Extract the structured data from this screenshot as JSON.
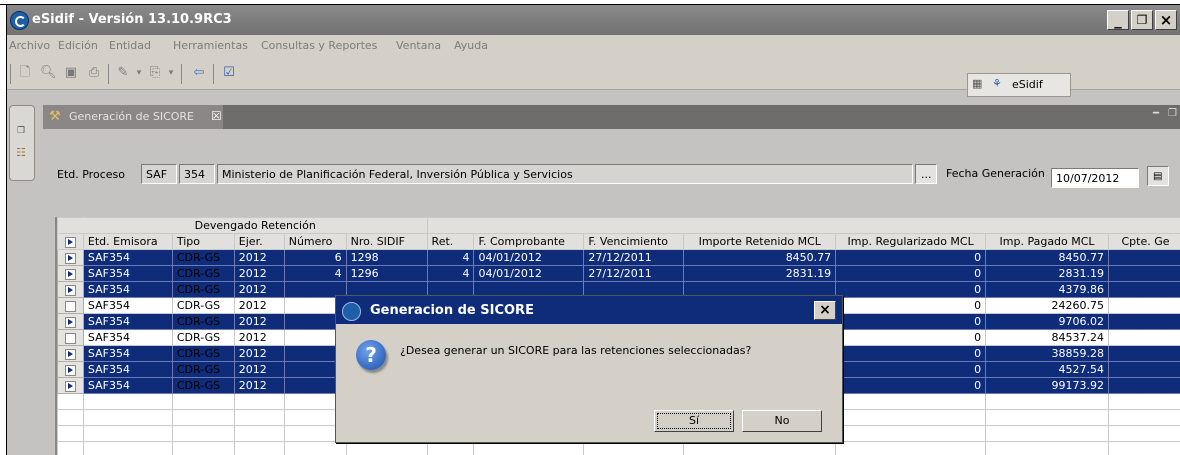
{
  "window": {
    "title": "eSidif - Versión 13.10.9RC3"
  },
  "menu": [
    "Archivo",
    "Edición",
    "Entidad",
    "Herramientas",
    "Consultas y Reportes",
    "Ventana",
    "Ayuda"
  ],
  "toolbar": {
    "perspective_label": "eSidif"
  },
  "tab": {
    "label": "Generación de SICORE"
  },
  "form": {
    "etd_proceso_label": "Etd. Proceso",
    "saf_code": "SAF",
    "saf_number": "354",
    "saf_name": "Ministerio de Planificación Federal, Inversión Pública y Servicios",
    "browse_label": "...",
    "fecha_label": "Fecha Generación",
    "fecha_value": "10/07/2012"
  },
  "grid": {
    "group_header": "Devengado Retención",
    "columns": [
      "Etd. Emisora",
      "Tipo",
      "Ejer.",
      "Número",
      "Nro. SIDIF",
      "Ret.",
      "F. Comprobante",
      "F. Vencimiento",
      "Importe Retenido MCL",
      "Imp. Regularizado MCL",
      "Imp. Pagado MCL",
      "Cpte. Ge"
    ],
    "rows": [
      {
        "selected": true,
        "cells": [
          "SAF354",
          "CDR-GS",
          "2012",
          "6",
          "1298",
          "4",
          "04/01/2012",
          "27/12/2011",
          "8450.77",
          "0",
          "8450.77",
          ""
        ]
      },
      {
        "selected": true,
        "cells": [
          "SAF354",
          "CDR-GS",
          "2012",
          "4",
          "1296",
          "4",
          "04/01/2012",
          "27/12/2011",
          "2831.19",
          "0",
          "2831.19",
          ""
        ]
      },
      {
        "selected": true,
        "cells": [
          "SAF354",
          "CDR-GS",
          "2012",
          "",
          "",
          "",
          "",
          "",
          "",
          "0",
          "4379.86",
          ""
        ]
      },
      {
        "selected": false,
        "cells": [
          "SAF354",
          "CDR-GS",
          "2012",
          "",
          "",
          "",
          "",
          "",
          "",
          "0",
          "24260.75",
          ""
        ]
      },
      {
        "selected": true,
        "cells": [
          "SAF354",
          "CDR-GS",
          "2012",
          "",
          "",
          "",
          "",
          "",
          "",
          "0",
          "9706.02",
          ""
        ]
      },
      {
        "selected": false,
        "cells": [
          "SAF354",
          "CDR-GS",
          "2012",
          "",
          "",
          "",
          "",
          "",
          "",
          "0",
          "84537.24",
          ""
        ]
      },
      {
        "selected": true,
        "cells": [
          "SAF354",
          "CDR-GS",
          "2012",
          "",
          "",
          "",
          "",
          "",
          "",
          "0",
          "38859.28",
          ""
        ]
      },
      {
        "selected": true,
        "cells": [
          "SAF354",
          "CDR-GS",
          "2012",
          "",
          "",
          "",
          "",
          "",
          "",
          "0",
          "4527.54",
          ""
        ]
      },
      {
        "selected": true,
        "cells": [
          "SAF354",
          "CDR-GS",
          "2012",
          "",
          "",
          "",
          "",
          "",
          "",
          "0",
          "99173.92",
          ""
        ]
      }
    ]
  },
  "dialog": {
    "title": "Generacion de SICORE",
    "message": "¿Desea generar un SICORE para las retenciones seleccionadas?",
    "yes_label": "Sí",
    "no_label": "No"
  },
  "colors": {
    "selection": "#0f2c7a",
    "titlebar": "#7a7a7a",
    "dialog_title": "#0f2c7a"
  }
}
